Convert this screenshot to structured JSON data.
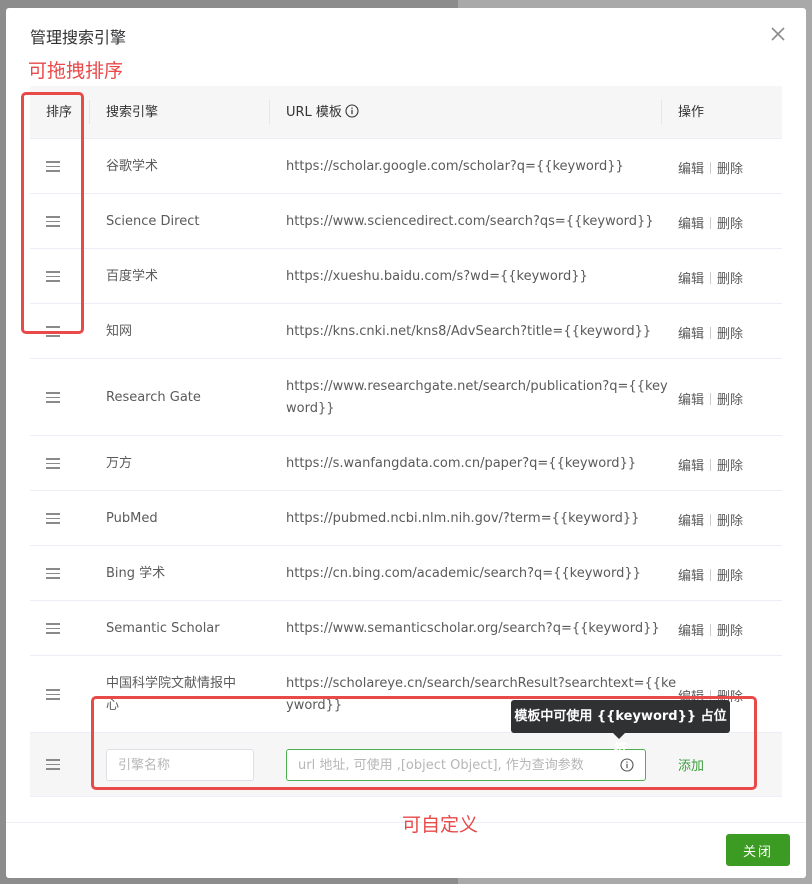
{
  "dialog": {
    "title": "管理搜索引擎",
    "close_icon": "close-icon"
  },
  "table": {
    "headers": {
      "sort": "排序",
      "engine": "搜索引擎",
      "url": "URL 模板",
      "ops": "操作"
    },
    "rows": [
      {
        "name": "谷歌学术",
        "url_lines": [
          "https://scholar.google.com/scholar?q={{keyword}}"
        ]
      },
      {
        "name": "Science Direct",
        "url_lines": [
          "https://www.sciencedirect.com/search?qs={{keyword}}"
        ]
      },
      {
        "name": "百度学术",
        "url_lines": [
          "https://xueshu.baidu.com/s?wd={{keyword}}"
        ]
      },
      {
        "name": "知网",
        "url_lines": [
          "https://kns.cnki.net/kns8/AdvSearch?title={{keyword}}"
        ]
      },
      {
        "name": "Research Gate",
        "url_lines": [
          "https://www.researchgate.net/search/publication?q={{key",
          "word}}"
        ]
      },
      {
        "name": "万方",
        "url_lines": [
          "https://s.wanfangdata.com.cn/paper?q={{keyword}}"
        ]
      },
      {
        "name": "PubMed",
        "url_lines": [
          "https://pubmed.ncbi.nlm.nih.gov/?term={{keyword}}"
        ]
      },
      {
        "name": "Bing 学术",
        "url_lines": [
          "https://cn.bing.com/academic/search?q={{keyword}}"
        ]
      },
      {
        "name": "Semantic Scholar",
        "url_lines": [
          "https://www.semanticscholar.org/search?q={{keyword}}"
        ]
      },
      {
        "name_lines": [
          "中国科学院文献情报中",
          "心"
        ],
        "url_lines": [
          "https://scholareye.cn/search/searchResult?searchtext={{ke",
          "yword}}"
        ]
      }
    ],
    "edit_label": "编辑",
    "delete_label": "删除"
  },
  "new_row": {
    "name_placeholder": "引擎名称",
    "url_placeholder": "url 地址, 可使用 ,[object Object], 作为查询参数",
    "add_label": "添加"
  },
  "tooltip": {
    "text": "模板中可使用 {{keyword}} 占位符"
  },
  "footer": {
    "close_label": "关闭"
  },
  "annotations": {
    "drag_sort": "可拖拽排序",
    "customizable": "可自定义"
  },
  "colors": {
    "primary_green": "#3c9b22",
    "annotation_red": "#e84a4a",
    "tooltip_bg": "#303133"
  }
}
